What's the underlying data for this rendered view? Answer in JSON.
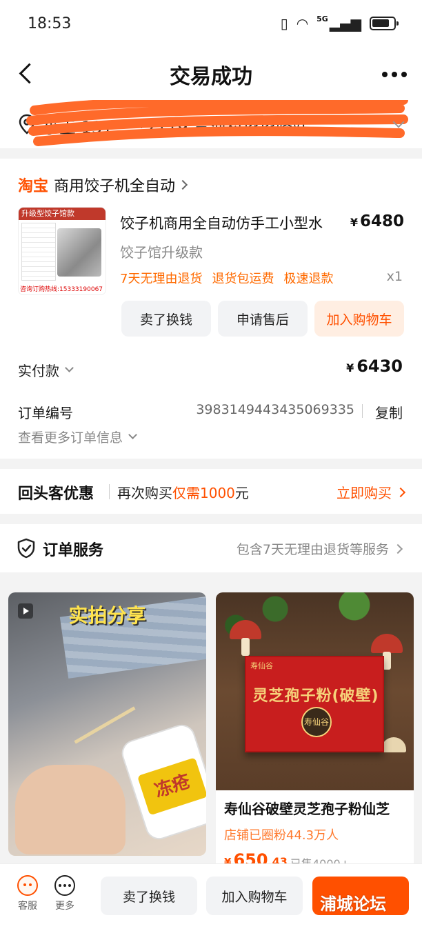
{
  "status_bar": {
    "time": "18:53",
    "network": "5G"
  },
  "nav": {
    "title": "交易成功"
  },
  "address": {
    "text": "小王 131****2119 三河村招招驿站"
  },
  "shop": {
    "platform": "淘宝",
    "name": "商用饺子机全自动"
  },
  "product": {
    "image_header": "升级型饺子馆款",
    "image_footer": "咨询订购热线:15333190067",
    "title": "饺子机商用全自动仿手工小型水",
    "currency": "¥",
    "price": "6480",
    "sku": "饺子馆升级款",
    "tags": [
      "7天无理由退货",
      "退货包运费",
      "极速退款"
    ],
    "quantity": "x1"
  },
  "actions": {
    "sell": "卖了换钱",
    "after_sale": "申请售后",
    "add_cart": "加入购物车"
  },
  "payment": {
    "label": "实付款",
    "currency": "¥",
    "amount": "6430"
  },
  "order": {
    "number_label": "订单编号",
    "number": "3983149443435069335",
    "copy": "复制",
    "more_info": "查看更多订单信息"
  },
  "promo": {
    "title": "回头客优惠",
    "text_prefix": "再次购买",
    "text_highlight": "仅需1000",
    "text_suffix": "元",
    "cta": "立即购买"
  },
  "service": {
    "title": "订单服务",
    "desc": "包含7天无理由退货等服务"
  },
  "feed": {
    "left": {
      "overlay": "实拍分享",
      "bottle_label": "冻疮"
    },
    "right": {
      "box_brand": "寿仙谷",
      "box_title": "灵芝孢子粉(破壁)",
      "seal": "寿仙谷",
      "title": "寿仙谷破壁灵芝孢子粉仙芝",
      "fans": "店铺已圈粉44.3万人",
      "currency": "¥",
      "price_int": "650",
      "price_dec": ".43",
      "sold": "已售4000+"
    }
  },
  "bottom": {
    "kefu": "客服",
    "more": "更多",
    "sell": "卖了换钱",
    "add_cart": "加入购物车",
    "watermark": "浦城论坛"
  },
  "colors": {
    "accent": "#ff5000",
    "tag": "#ff6a00",
    "scribble": "#ff6a2a"
  }
}
